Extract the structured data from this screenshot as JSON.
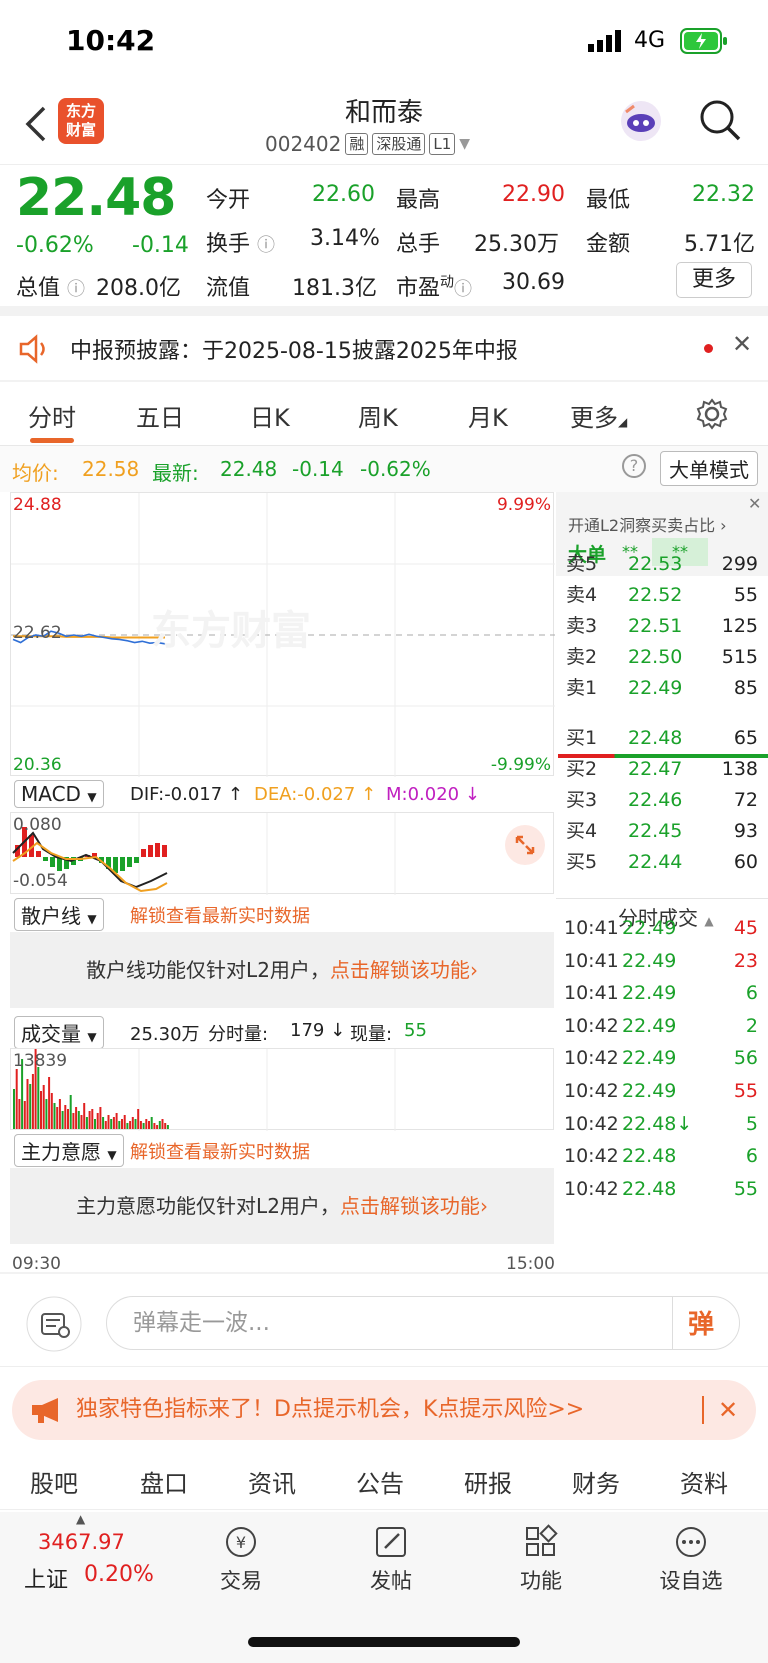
{
  "status": {
    "time": "10:42",
    "network": "4G"
  },
  "header": {
    "logo_line1": "东方",
    "logo_line2": "财富",
    "name": "和而泰",
    "code": "002402",
    "tags": [
      "融",
      "深股通",
      "L1"
    ]
  },
  "quote": {
    "price": "22.48",
    "pct": "-0.62%",
    "chg": "-0.14",
    "open_label": "今开",
    "open": "22.60",
    "high_label": "最高",
    "high": "22.90",
    "low_label": "最低",
    "low": "22.32",
    "turnover_label": "换手",
    "turnover": "3.14%",
    "volume_label": "总手",
    "volume": "25.30万",
    "amount_label": "金额",
    "amount": "5.71亿",
    "mcap_label": "总值",
    "mcap": "208.0亿",
    "float_label": "流值",
    "float": "181.3亿",
    "pe_label": "市盈",
    "pe_sup": "动",
    "pe": "30.69",
    "more": "更多"
  },
  "notice": {
    "text": "中报预披露：于2025-08-15披露2025年中报"
  },
  "tabs": [
    "分时",
    "五日",
    "日K",
    "周K",
    "月K",
    "更多"
  ],
  "info": {
    "avg_label": "均价:",
    "avg": "22.58",
    "last_label": "最新:",
    "last": "22.48",
    "chg": "-0.14",
    "pct": "-0.62%",
    "mode_btn": "大单模式"
  },
  "chart": {
    "ymax": "24.88",
    "ymid": "22.62",
    "ymin": "20.36",
    "pmax": "9.99%",
    "pmin": "-9.99%",
    "watermark": "东方财富",
    "t_start": "09:30",
    "t_end": "15:00",
    "price_series": [
      22.55,
      22.5,
      22.58,
      22.62,
      22.6,
      22.68,
      22.65,
      22.6,
      22.62,
      22.6,
      22.63,
      22.6,
      22.58,
      22.56,
      22.55,
      22.53,
      22.5,
      22.52,
      22.49,
      22.5,
      22.48
    ],
    "avg_series": [
      22.6,
      22.6,
      22.6,
      22.6,
      22.6,
      22.6,
      22.6,
      22.59,
      22.59,
      22.59,
      22.59,
      22.59,
      22.59,
      22.58,
      22.58,
      22.58,
      22.58,
      22.58,
      22.58,
      22.58,
      22.58
    ]
  },
  "macd": {
    "label": "MACD",
    "dif": "DIF:-0.017 ↑",
    "dea": "DEA:-0.027 ↑",
    "m": "M:0.020 ↓",
    "top": "0.080",
    "bottom": "-0.054"
  },
  "retail": {
    "label": "散户线",
    "unlock": "解锁查看最新实时数据",
    "lock_text": "散户线功能仅针对L2用户，",
    "lock_link": "点击解锁该功能"
  },
  "vol": {
    "label": "成交量",
    "total": "25.30万",
    "min_label": "分时量:",
    "min_val": "179 ↓",
    "now_label": "现量:",
    "now": "55",
    "max": "13839"
  },
  "main": {
    "label": "主力意愿",
    "unlock": "解锁查看最新实时数据",
    "lock_text": "主力意愿功能仅针对L2用户，",
    "lock_link": "点击解锁该功能"
  },
  "right": {
    "title": "开通L2洞察买卖占比 ›",
    "big_label": "大单",
    "big_v1": "**",
    "big_v2": "**",
    "sells": [
      {
        "label": "卖5",
        "price": "22.53",
        "vol": "299"
      },
      {
        "label": "卖4",
        "price": "22.52",
        "vol": "55"
      },
      {
        "label": "卖3",
        "price": "22.51",
        "vol": "125"
      },
      {
        "label": "卖2",
        "price": "22.50",
        "vol": "515"
      },
      {
        "label": "卖1",
        "price": "22.49",
        "vol": "85"
      }
    ],
    "buys": [
      {
        "label": "买1",
        "price": "22.48",
        "vol": "65"
      },
      {
        "label": "买2",
        "price": "22.47",
        "vol": "138"
      },
      {
        "label": "买3",
        "price": "22.46",
        "vol": "72"
      },
      {
        "label": "买4",
        "price": "22.45",
        "vol": "93"
      },
      {
        "label": "买5",
        "price": "22.44",
        "vol": "60"
      }
    ],
    "trades_title": "分时成交",
    "trades": [
      {
        "t": "10:41",
        "p": "22.49",
        "v": "45",
        "c": "red"
      },
      {
        "t": "10:41",
        "p": "22.49",
        "v": "23",
        "c": "red"
      },
      {
        "t": "10:41",
        "p": "22.49",
        "v": "6",
        "c": "green"
      },
      {
        "t": "10:42",
        "p": "22.49",
        "v": "2",
        "c": "green"
      },
      {
        "t": "10:42",
        "p": "22.49",
        "v": "56",
        "c": "green"
      },
      {
        "t": "10:42",
        "p": "22.49",
        "v": "55",
        "c": "red"
      },
      {
        "t": "10:42",
        "p": "22.48↓",
        "v": "5",
        "c": "green"
      },
      {
        "t": "10:42",
        "p": "22.48",
        "v": "6",
        "c": "green"
      },
      {
        "t": "10:42",
        "p": "22.48",
        "v": "55",
        "c": "green"
      }
    ]
  },
  "danmu": {
    "placeholder": "弹幕走一波...",
    "btn": "弹"
  },
  "ad": {
    "text": "独家特色指标来了！D点提示机会，K点提示风险>>"
  },
  "ftabs": [
    "股吧",
    "盘口",
    "资讯",
    "公告",
    "研报",
    "财务",
    "资料"
  ],
  "nav": {
    "index_val": "3467.97",
    "index_name": "上证",
    "index_pct": "0.20%",
    "items": [
      "交易",
      "发帖",
      "功能",
      "设自选"
    ]
  }
}
